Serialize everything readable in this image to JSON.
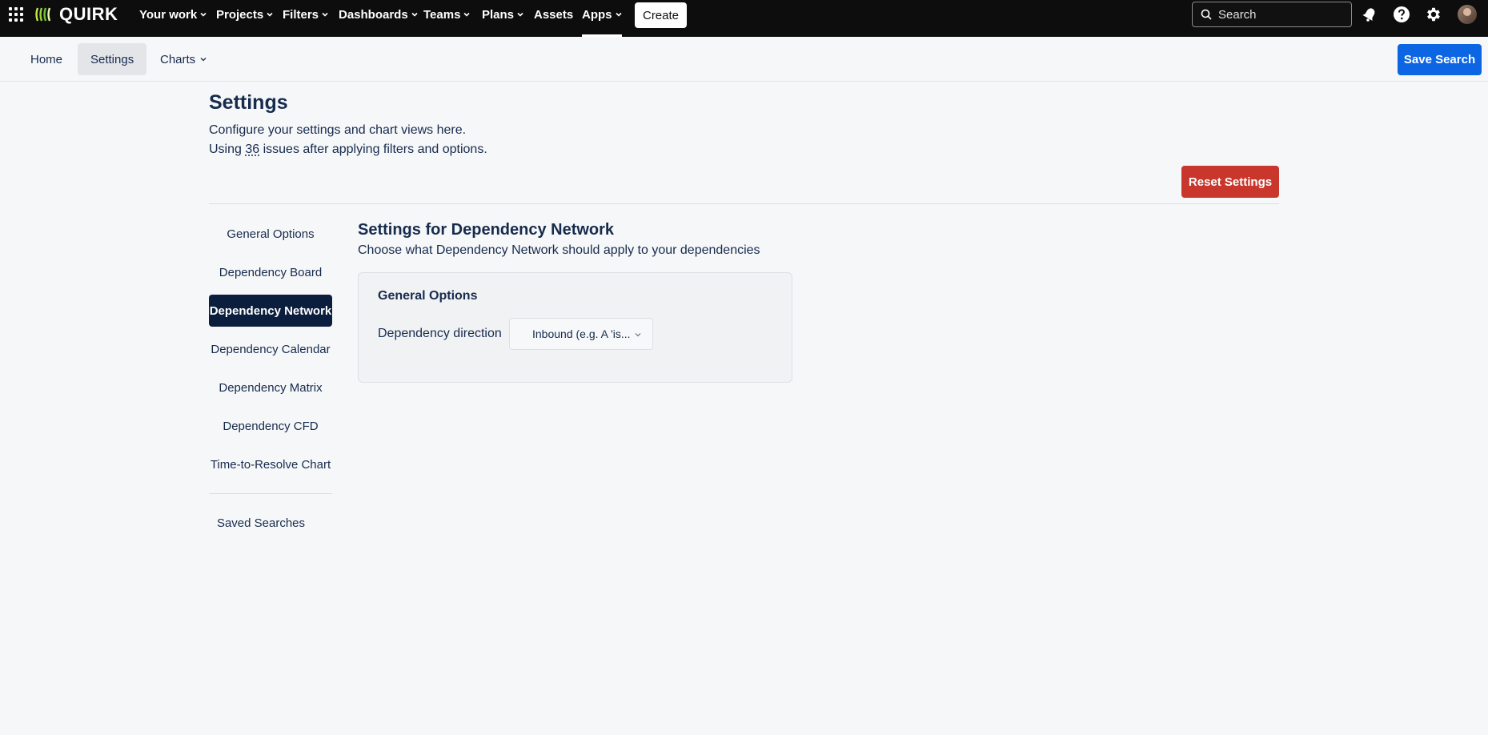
{
  "topnav": {
    "logo_text": "QUIRK",
    "items": [
      {
        "label": "Your work"
      },
      {
        "label": "Projects"
      },
      {
        "label": "Filters"
      },
      {
        "label": "Dashboards"
      },
      {
        "label": "Teams"
      },
      {
        "label": "Plans"
      },
      {
        "label": "Assets"
      },
      {
        "label": "Apps"
      }
    ],
    "create_label": "Create",
    "search_placeholder": "Search"
  },
  "subnav": {
    "tabs": [
      {
        "label": "Home"
      },
      {
        "label": "Settings"
      },
      {
        "label": "Charts"
      }
    ],
    "save_search_label": "Save Search"
  },
  "page": {
    "title": "Settings",
    "desc1": "Configure your settings and chart views here.",
    "desc2_prefix": "Using ",
    "issue_count": "36",
    "desc2_suffix": " issues after applying filters and options.",
    "reset_label": "Reset Settings"
  },
  "sidemenu": {
    "items": [
      {
        "label": "General Options"
      },
      {
        "label": "Dependency Board"
      },
      {
        "label": "Dependency Network"
      },
      {
        "label": "Dependency Calendar"
      },
      {
        "label": "Dependency Matrix"
      },
      {
        "label": "Dependency CFD"
      },
      {
        "label": "Time-to-Resolve Chart"
      }
    ],
    "saved_searches": "Saved Searches"
  },
  "content": {
    "title": "Settings for Dependency Network",
    "desc": "Choose what Dependency Network should apply to your dependencies",
    "card": {
      "title": "General Options",
      "direction_label": "Dependency direction",
      "direction_value": "Inbound (e.g. A 'is..."
    }
  },
  "colors": {
    "primary": "#0c66e4",
    "danger": "#c9372c",
    "active_nav": "#0c1e3d",
    "topbar": "#0d0d0d"
  }
}
